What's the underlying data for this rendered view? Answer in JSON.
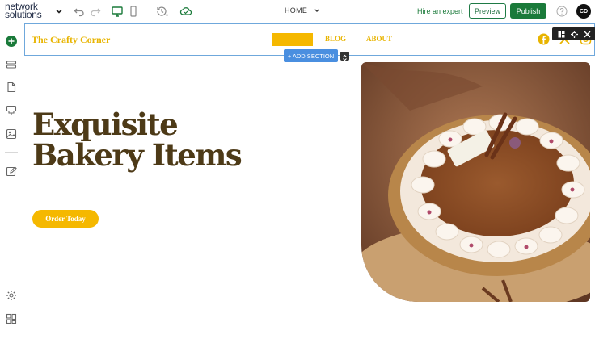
{
  "app": {
    "logo_line1": "network",
    "logo_line2": "solutions",
    "page_selector": "HOME",
    "hire_expert": "Hire an expert",
    "preview": "Preview",
    "publish": "Publish",
    "avatar_initials": "CD"
  },
  "site": {
    "title": "The Crafty Corner",
    "nav": [
      "",
      "BLOG",
      "ABOUT"
    ],
    "add_section": "+ ADD SECTION",
    "hero_title_line1": "Exquisite",
    "hero_title_line2": "Bakery Items",
    "cta": "Order Today"
  },
  "colors": {
    "accent": "#f5b800",
    "brand_green": "#1a7a3a",
    "hero_text": "#4d3a17",
    "selection_blue": "#6fa8dc"
  },
  "icons": {
    "toolbar": [
      "undo-icon",
      "redo-icon",
      "desktop-icon",
      "mobile-icon",
      "history-icon",
      "cloud-icon"
    ],
    "sidebar": [
      "add-icon",
      "sections-icon",
      "pages-icon",
      "design-icon",
      "media-icon",
      "edit-icon",
      "settings-icon",
      "apps-icon"
    ],
    "social": [
      "facebook-icon",
      "x-icon",
      "instagram-icon"
    ]
  }
}
